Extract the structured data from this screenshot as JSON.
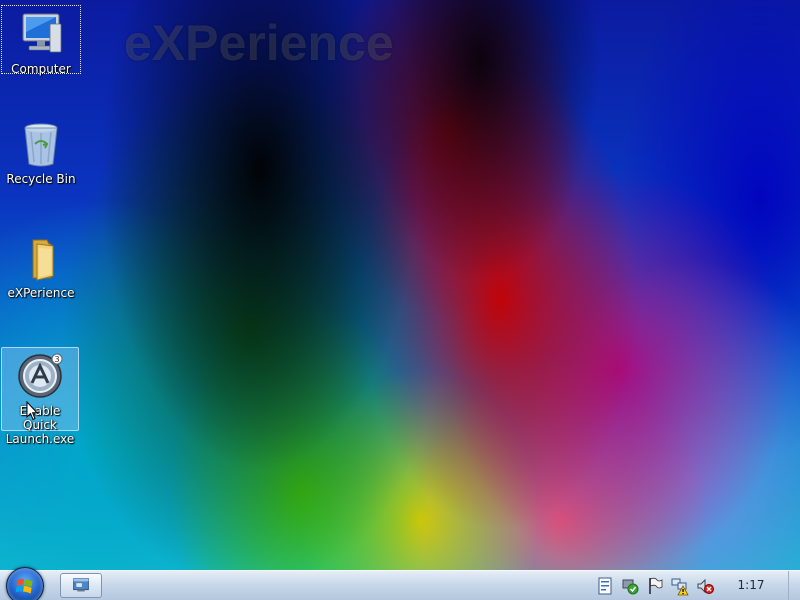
{
  "wallpaper": {
    "logo_text": "eXPerience"
  },
  "desktop_icons": [
    {
      "label": "Computer",
      "icon": "computer-icon"
    },
    {
      "label": "Recycle Bin",
      "icon": "recycle-bin-icon"
    },
    {
      "label": "eXPerience",
      "icon": "folder-icon"
    },
    {
      "label": "Enable Quick Launch.exe",
      "icon": "autoit-app-icon"
    }
  ],
  "taskbar": {
    "start_button": "start-orb-icon",
    "task_buttons": [
      {
        "icon": "desktop-window-icon"
      }
    ],
    "tray_icons": [
      "document-icon",
      "safely-remove-hardware-icon",
      "action-center-flag-icon",
      "network-warning-icon",
      "volume-muted-icon"
    ],
    "clock": "1:17"
  },
  "colors": {
    "taskbar_light": "#e6eef7",
    "taskbar_dark": "#b3c7df",
    "selection": "#96c8f5"
  }
}
